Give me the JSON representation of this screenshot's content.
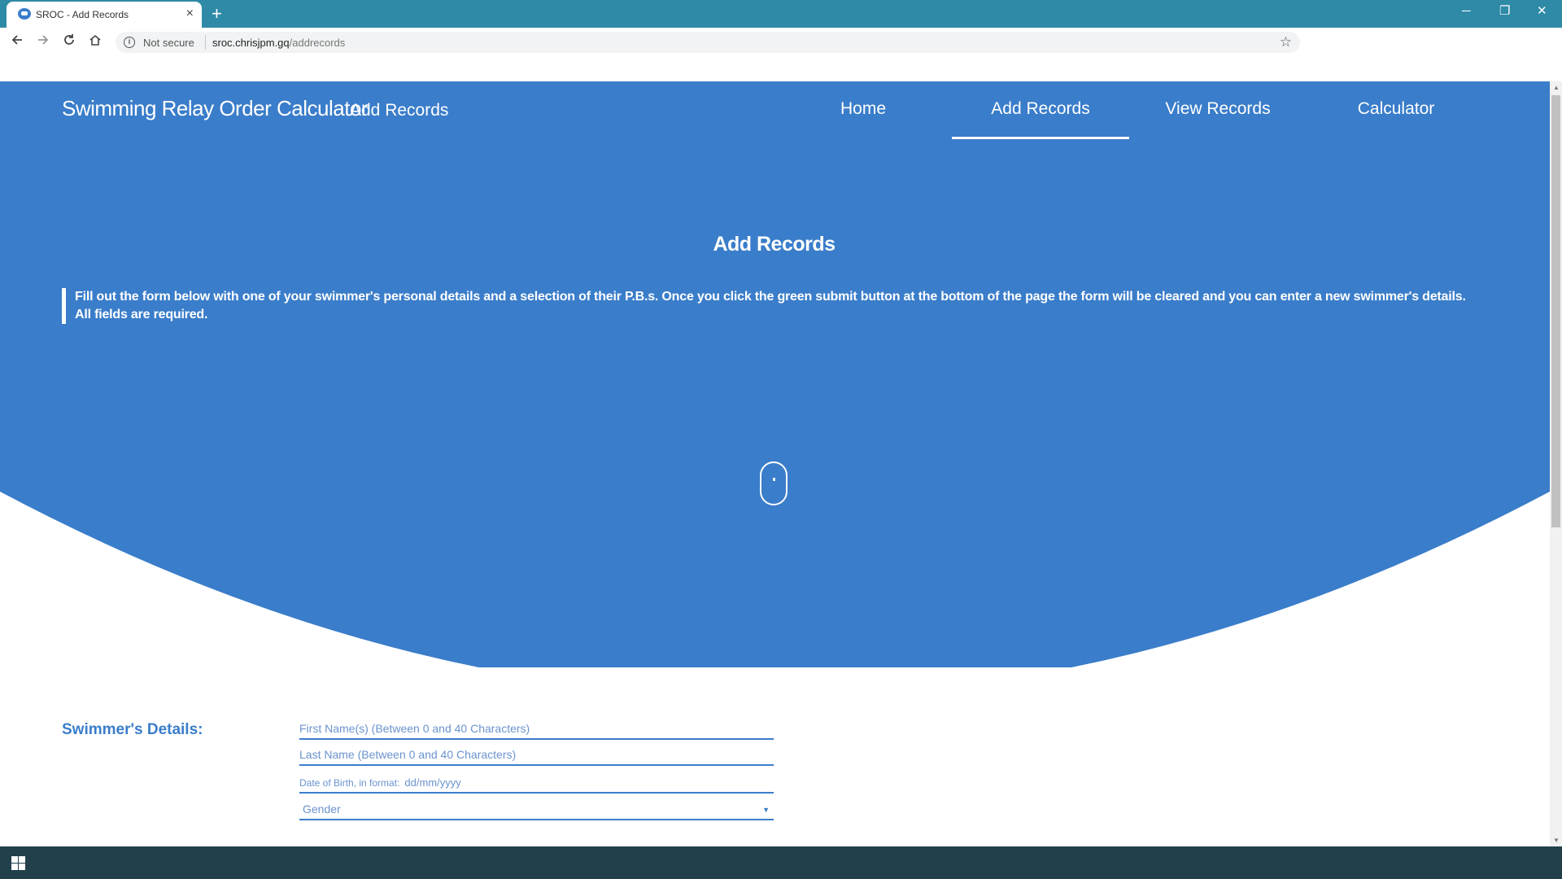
{
  "browser": {
    "tab_title": "SROC - Add Records",
    "tab_close_glyph": "×",
    "new_tab_glyph": "+",
    "security_label": "Not secure",
    "url_host": "sroc.chrisjpm.gq",
    "url_path": "/addrecords",
    "window_controls": [
      "─",
      "❐",
      "✕"
    ]
  },
  "nav_icons": [
    "arrow-left-icon",
    "arrow-right-icon",
    "reload-icon",
    "home-icon"
  ],
  "header": {
    "brand": "Swimming Relay Order Calculator",
    "brand_sub": "Add Records",
    "nav": [
      {
        "label": "Home",
        "active": false
      },
      {
        "label": "Add Records",
        "active": true
      },
      {
        "label": "View Records",
        "active": false
      },
      {
        "label": "Calculator",
        "active": false
      }
    ]
  },
  "hero": {
    "title": "Add Records",
    "description": "Fill out the form below with one of your swimmer's personal details and a selection of their P.B.s. Once you click the green submit button at the bottom of the page the form will be cleared and you can enter a new swimmer's details.",
    "description_strong": "All fields are required."
  },
  "form": {
    "section_label": "Swimmer's Details:",
    "first_name_placeholder": "First Name(s) (Between 0 and 40 Characters)",
    "last_name_placeholder": "Last Name (Between 0 and 40 Characters)",
    "dob_label": "Date of Birth, in format:",
    "dob_value": "dd/mm/yyyy",
    "gender_selected": "Gender"
  },
  "colors": {
    "accent": "#3a7dca",
    "tabbar": "#2e8aa6",
    "taskbar": "#223f4c"
  }
}
